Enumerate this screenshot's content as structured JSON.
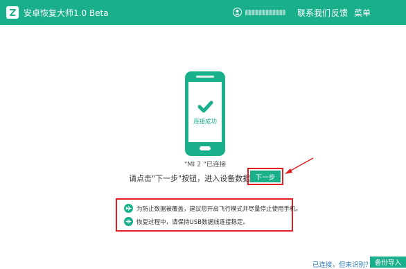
{
  "app": {
    "title": "安卓恢复大师1.0 Beta",
    "brand_color": "#1aaf8b"
  },
  "header": {
    "user_icon": "user-icon",
    "menu": [
      {
        "label": "联系我们"
      },
      {
        "label": "反馈"
      },
      {
        "label": "菜单"
      }
    ]
  },
  "phone": {
    "icon": "phone-icon",
    "check_icon": "check-icon",
    "status_text": "连接成功"
  },
  "device": {
    "connected_text": "\"MI 2 \"已连接"
  },
  "instruction": {
    "text": "请点击\"下一步\"按钮，进入设备数据扫描",
    "next_label": "下一步"
  },
  "tips": [
    {
      "icon": "airplane-icon",
      "text": "为防止数据被覆盖，建议您开启飞行模式并尽量停止使用手机。"
    },
    {
      "icon": "usb-icon",
      "text": "恢复过程中，请保持USB数据线连接稳定。"
    }
  ],
  "footer": {
    "unrecognized_link": "已连接，但未识别？",
    "backup_label": "备份导入"
  },
  "highlight_color": "#e31b23"
}
